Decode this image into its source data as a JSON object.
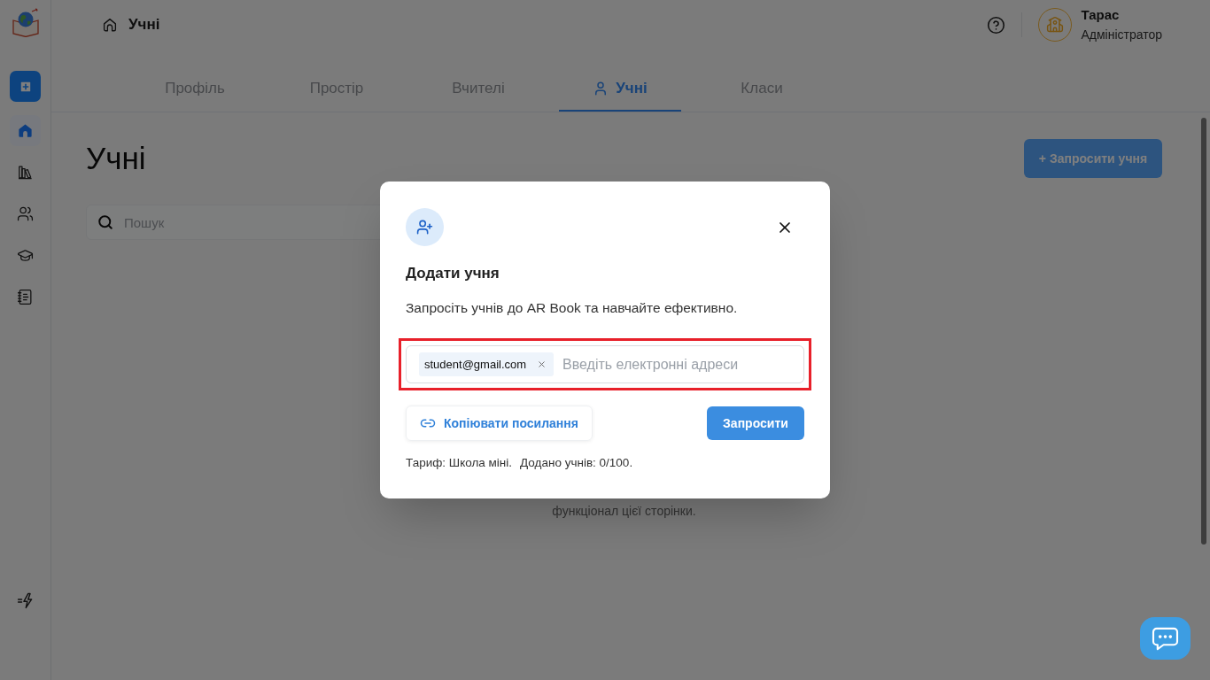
{
  "sidebar": {
    "nav": [
      {
        "selected": true
      },
      {
        "selected": false
      },
      {
        "selected": false
      },
      {
        "selected": false
      },
      {
        "selected": false
      }
    ]
  },
  "header": {
    "breadcrumb": "Учні",
    "user": {
      "name": "Тарас",
      "role": "Адміністратор"
    }
  },
  "tabs": [
    {
      "label": "Профіль",
      "selected": false
    },
    {
      "label": "Простір",
      "selected": false
    },
    {
      "label": "Вчителі",
      "selected": false
    },
    {
      "label": "Учні",
      "selected": true
    },
    {
      "label": "Класи",
      "selected": false
    }
  ],
  "page": {
    "title": "Учні",
    "invite_button": "+ Запросити учня",
    "search": {
      "placeholder": "Пошук"
    },
    "empty_note": "функціонал цієї сторінки."
  },
  "modal": {
    "title": "Додати учня",
    "description": "Запросіть учнів до AR Book та навчайте ефективно.",
    "emails": {
      "chips": [
        "student@gmail.com"
      ],
      "placeholder": "Введіть електронні адреси",
      "highlighted": true
    },
    "copy_link_button": "Копіювати посилання",
    "invite_button": "Запросити",
    "plan": "Тариф: Школа міні.",
    "count": "Додано учнів: 0/100."
  }
}
